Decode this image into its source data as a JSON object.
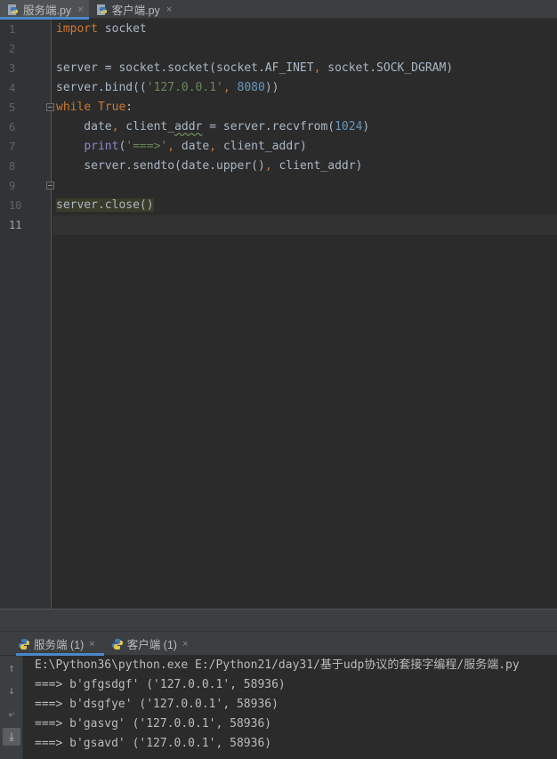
{
  "editor_tabs": [
    {
      "label": "服务端.py",
      "active": true
    },
    {
      "label": "客户端.py",
      "active": false
    }
  ],
  "line_numbers": [
    "1",
    "2",
    "3",
    "4",
    "5",
    "6",
    "7",
    "8",
    "9",
    "10",
    "11"
  ],
  "code": {
    "l1": {
      "kw": "import",
      "rest": " socket"
    },
    "l3": {
      "a": "server = socket.socket(socket.AF_INET",
      "comma": ",",
      "b": " socket.SOCK_DGRAM)"
    },
    "l4": {
      "a": "server.bind((",
      "str": "'127.0.0.1'",
      "comma": ",",
      "sp": " ",
      "num": "8080",
      "b": "))"
    },
    "l5": {
      "kw": "while",
      "sp": " ",
      "kw2": "True",
      "b": ":"
    },
    "l6": {
      "a": "    date",
      "comma": ",",
      "b": " client_",
      "w": "addr",
      "c": " = server.recvfrom(",
      "num": "1024",
      "d": ")"
    },
    "l7": {
      "ind": "    ",
      "bi": "print",
      "a": "(",
      "str": "'===>'",
      "comma": ",",
      "b": " date",
      "comma2": ",",
      "c": " client_addr)"
    },
    "l8": {
      "a": "    server.sendto(date.upper()",
      "comma": ",",
      "b": " client_addr)"
    },
    "l10": {
      "a": "server.close()"
    }
  },
  "run_tabs": [
    {
      "label": "服务端 (1)",
      "active": true
    },
    {
      "label": "客户端 (1)",
      "active": false
    }
  ],
  "console_lines": [
    "E:\\Python36\\python.exe E:/Python21/day31/基于udp协议的套接字编程/服务端.py",
    "===> b'gfgsdgf' ('127.0.0.1', 58936)",
    "===> b'dsgfye' ('127.0.0.1', 58936)",
    "===> b'gasvg' ('127.0.0.1', 58936)",
    "===> b'gsavd' ('127.0.0.1', 58936)"
  ],
  "icons": {
    "file": "python-file-icon",
    "close": "close-icon",
    "up": "arrow-up-icon",
    "down": "arrow-down-icon",
    "wrap": "soft-wrap-icon",
    "scroll": "scroll-to-end-icon"
  },
  "colors": {
    "accent": "#4a88c7",
    "keyword": "#cc7832",
    "string": "#6a8759",
    "number": "#6897bb"
  },
  "glyphs": {
    "close": "×",
    "up": "↑",
    "down": "↓",
    "wrap": "⤶",
    "scroll": "⤓"
  }
}
